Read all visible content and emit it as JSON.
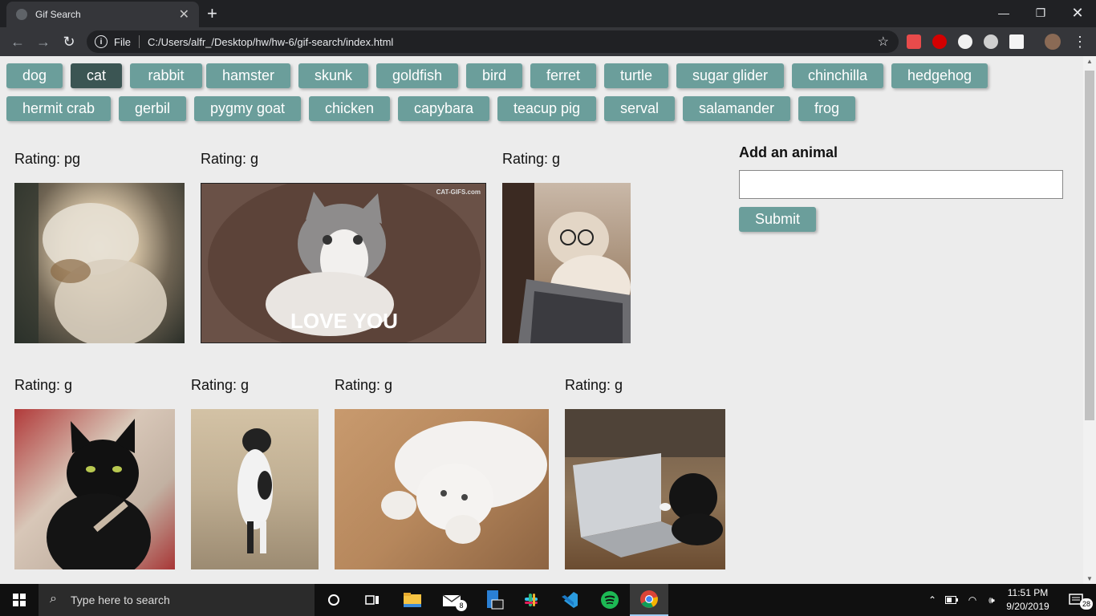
{
  "browser": {
    "tab_title": "Gif Search",
    "new_tab": "+",
    "url_scheme": "File",
    "url": "C:/Users/alfr_/Desktop/hw/hw-6/gif-search/index.html"
  },
  "animals": [
    "dog",
    "cat",
    "rabbit",
    "hamster",
    "skunk",
    "goldfish",
    "bird",
    "ferret",
    "turtle",
    "sugar glider",
    "chinchilla",
    "hedgehog",
    "hermit crab",
    "gerbil",
    "pygmy goat",
    "chicken",
    "capybara",
    "teacup pig",
    "serval",
    "salamander",
    "frog"
  ],
  "selected_animal": "cat",
  "gifs": [
    {
      "rating": "Rating: pg",
      "description": "fluffy cat shaking head"
    },
    {
      "rating": "Rating: g",
      "description": "grey and white cat reaching",
      "caption": "LOVE YOU",
      "watermark": "CAT-GIFS.com"
    },
    {
      "rating": "Rating: g",
      "description": "cat with glasses on laptop"
    },
    {
      "rating": "Rating: g",
      "description": "black cat with nail file"
    },
    {
      "rating": "Rating: g",
      "description": "cat standing on hind legs"
    },
    {
      "rating": "Rating: g",
      "description": "white cat rolling on floor"
    },
    {
      "rating": "Rating: g",
      "description": "black cat on macbook"
    }
  ],
  "form": {
    "title": "Add an animal",
    "input_value": "",
    "submit_label": "Submit"
  },
  "taskbar": {
    "search_placeholder": "Type here to search",
    "mail_badge": "8",
    "time": "11:51 PM",
    "date": "9/20/2019",
    "notification_count": "28"
  },
  "colors": {
    "button": "#6b9e9b",
    "button_active": "#3b5553",
    "page_bg": "#ececec"
  }
}
